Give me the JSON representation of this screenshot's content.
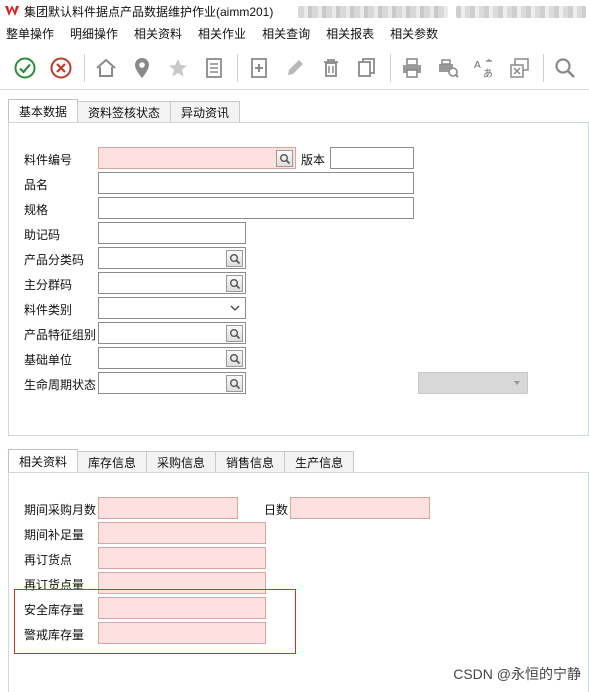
{
  "window": {
    "title": "集团默认料件据点产品数据维护作业(aimm201)"
  },
  "menubar": {
    "items": [
      {
        "label": "整单操作"
      },
      {
        "label": "明细操作"
      },
      {
        "label": "相关资料"
      },
      {
        "label": "相关作业"
      },
      {
        "label": "相关查询"
      },
      {
        "label": "相关报表"
      },
      {
        "label": "相关参数"
      }
    ]
  },
  "toolbar": {
    "buttons": [
      {
        "icon": "check-circle-icon",
        "color": "#2e8b3a"
      },
      {
        "icon": "cancel-circle-icon",
        "color": "#c0392b"
      },
      {
        "icon": "home-icon"
      },
      {
        "icon": "location-pin-icon"
      },
      {
        "icon": "star-icon"
      },
      {
        "icon": "list-document-icon"
      },
      {
        "icon": "new-document-icon"
      },
      {
        "icon": "pencil-edit-icon"
      },
      {
        "icon": "trash-icon"
      },
      {
        "icon": "copy-icon"
      },
      {
        "icon": "printer-icon"
      },
      {
        "icon": "print-preview-icon"
      },
      {
        "icon": "translate-icon"
      },
      {
        "icon": "close-window-icon"
      },
      {
        "icon": "search-icon"
      }
    ]
  },
  "top_tabs": [
    {
      "label": "基本数据",
      "active": true
    },
    {
      "label": "资料签核状态",
      "active": false
    },
    {
      "label": "异动资讯",
      "active": false
    }
  ],
  "basic": {
    "item_no": {
      "label": "料件编号",
      "value": ""
    },
    "version": {
      "label": "版本",
      "value": ""
    },
    "name": {
      "label": "品名",
      "value": ""
    },
    "spec": {
      "label": "规格",
      "value": ""
    },
    "mnemonic": {
      "label": "助记码",
      "value": ""
    },
    "product_category": {
      "label": "产品分类码",
      "value": ""
    },
    "main_group": {
      "label": "主分群码",
      "value": ""
    },
    "item_type": {
      "label": "料件类别",
      "value": ""
    },
    "feature_group": {
      "label": "产品特征组别",
      "value": ""
    },
    "base_unit": {
      "label": "基础单位",
      "value": ""
    },
    "lifecycle": {
      "label": "生命周期状态",
      "value": ""
    }
  },
  "bottom_tabs": [
    {
      "label": "相关资料",
      "active": true
    },
    {
      "label": "库存信息",
      "active": false
    },
    {
      "label": "采购信息",
      "active": false
    },
    {
      "label": "销售信息",
      "active": false
    },
    {
      "label": "生产信息",
      "active": false
    }
  ],
  "related": {
    "purchase_months": {
      "label": "期间采购月数",
      "value": ""
    },
    "days": {
      "label": "日数",
      "value": ""
    },
    "replenish_qty": {
      "label": "期间补足量",
      "value": ""
    },
    "reorder_point": {
      "label": "再订货点",
      "value": ""
    },
    "reorder_qty": {
      "label": "再订货点量",
      "value": ""
    },
    "safety_stock": {
      "label": "安全库存量",
      "value": ""
    },
    "alert_stock": {
      "label": "警戒库存量",
      "value": ""
    }
  },
  "watermark": "CSDN @永恒的宁静",
  "colors": {
    "required_field": "#fde0e0",
    "highlight_box": "#c0392b"
  }
}
